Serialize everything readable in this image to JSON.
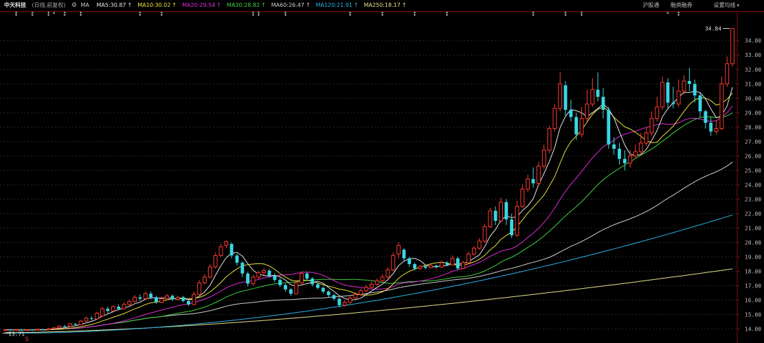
{
  "header": {
    "stock_name": "中天科技",
    "period": "(日线,前复权)",
    "ma_label": "MA",
    "ma_items": [
      {
        "name": "MA5",
        "value": "30.87",
        "color": "#e6e6e6"
      },
      {
        "name": "MA10",
        "value": "30.02",
        "color": "#e8e13a"
      },
      {
        "name": "MA20",
        "value": "29.54",
        "color": "#e02ad8"
      },
      {
        "name": "MA30",
        "value": "28.82",
        "color": "#3fd23f"
      },
      {
        "name": "MA60",
        "value": "26.47",
        "color": "#cfcfcf"
      },
      {
        "name": "MA120",
        "value": "21.91",
        "color": "#2ab4e6"
      },
      {
        "name": "MA250",
        "value": "18.17",
        "color": "#e8e28a"
      }
    ]
  },
  "toolbar": {
    "link_hgt": "沪股通",
    "link_margin": "融资融券",
    "link_settings": "设置均线"
  },
  "chart_data": {
    "type": "candlestick",
    "y_axis_ticks": [
      "14.00",
      "15.00",
      "16.00",
      "17.00",
      "18.00",
      "19.00",
      "20.00",
      "21.00",
      "22.00",
      "23.00",
      "24.00",
      "25.00",
      "26.00",
      "27.00",
      "28.00",
      "29.00",
      "30.00",
      "31.00",
      "32.00",
      "33.00",
      "34.00"
    ],
    "ylim": [
      13.6,
      35.2
    ],
    "high_label": "34.84",
    "low_label": "13.71",
    "colors": {
      "up": "#ff3b30",
      "down": "#39d7e3",
      "grid": "#2a2a2a"
    },
    "candles": [
      [
        13.9,
        13.95,
        13.88,
        13.98
      ],
      [
        13.95,
        13.92,
        13.85,
        14.0
      ],
      [
        13.92,
        13.96,
        13.86,
        14.01
      ],
      [
        13.96,
        13.9,
        13.84,
        14.0
      ],
      [
        13.9,
        13.95,
        13.85,
        13.99
      ],
      [
        13.95,
        13.93,
        13.86,
        14.0
      ],
      [
        13.93,
        13.98,
        13.89,
        14.03
      ],
      [
        13.98,
        13.96,
        13.91,
        14.03
      ],
      [
        13.96,
        14.02,
        13.92,
        14.08
      ],
      [
        14.02,
        14.08,
        13.98,
        14.13
      ],
      [
        14.08,
        14.2,
        14.04,
        14.26
      ],
      [
        14.2,
        14.18,
        14.1,
        14.28
      ],
      [
        14.18,
        14.35,
        14.15,
        14.43
      ],
      [
        14.35,
        14.3,
        14.22,
        14.42
      ],
      [
        14.3,
        14.55,
        14.27,
        14.62
      ],
      [
        14.55,
        14.75,
        14.5,
        14.85
      ],
      [
        14.75,
        14.7,
        14.6,
        14.9
      ],
      [
        14.7,
        15.1,
        14.66,
        15.2
      ],
      [
        14.9,
        15.4,
        14.86,
        15.55
      ],
      [
        15.4,
        15.25,
        15.1,
        15.55
      ],
      [
        15.25,
        15.55,
        15.2,
        15.65
      ],
      [
        15.55,
        15.4,
        15.3,
        15.7
      ],
      [
        15.4,
        15.7,
        15.35,
        15.85
      ],
      [
        15.7,
        15.9,
        15.6,
        16.05
      ],
      [
        15.9,
        16.2,
        15.85,
        16.35
      ],
      [
        16.2,
        16.1,
        15.95,
        16.4
      ],
      [
        16.1,
        16.45,
        16.0,
        16.6
      ],
      [
        16.45,
        16.2,
        16.05,
        16.6
      ],
      [
        16.2,
        15.85,
        15.75,
        16.3
      ],
      [
        15.85,
        16.1,
        15.8,
        16.25
      ],
      [
        16.1,
        16.3,
        16.0,
        16.45
      ],
      [
        16.3,
        16.05,
        15.95,
        16.4
      ],
      [
        16.05,
        16.2,
        15.95,
        16.3
      ],
      [
        16.2,
        15.95,
        15.85,
        16.3
      ],
      [
        15.95,
        15.7,
        15.6,
        16.0
      ],
      [
        15.7,
        16.4,
        15.65,
        16.6
      ],
      [
        16.4,
        17.2,
        16.35,
        17.4
      ],
      [
        17.2,
        17.6,
        17.1,
        17.8
      ],
      [
        17.6,
        18.3,
        17.5,
        18.5
      ],
      [
        18.3,
        19.1,
        18.2,
        19.3
      ],
      [
        19.1,
        19.7,
        19.0,
        19.9
      ],
      [
        19.8,
        20.05,
        19.6,
        20.15
      ],
      [
        19.9,
        19.1,
        18.9,
        20.0
      ],
      [
        19.1,
        18.6,
        18.4,
        19.2
      ],
      [
        18.6,
        17.85,
        17.6,
        18.7
      ],
      [
        17.85,
        17.15,
        16.95,
        17.95
      ],
      [
        17.15,
        17.6,
        17.0,
        17.75
      ],
      [
        17.6,
        17.9,
        17.45,
        18.05
      ],
      [
        17.9,
        18.05,
        17.75,
        18.2
      ],
      [
        18.05,
        17.7,
        17.55,
        18.15
      ],
      [
        17.7,
        17.4,
        17.25,
        17.85
      ],
      [
        17.4,
        17.05,
        16.9,
        17.55
      ],
      [
        17.05,
        16.75,
        16.6,
        17.15
      ],
      [
        16.75,
        16.45,
        16.3,
        16.85
      ],
      [
        16.45,
        17.2,
        16.4,
        17.4
      ],
      [
        17.2,
        17.85,
        17.1,
        18.0
      ],
      [
        17.85,
        17.5,
        17.35,
        17.95
      ],
      [
        17.5,
        17.1,
        16.95,
        17.6
      ],
      [
        17.1,
        16.85,
        16.75,
        17.2
      ],
      [
        16.85,
        16.6,
        16.45,
        16.95
      ],
      [
        16.6,
        16.35,
        16.2,
        16.7
      ],
      [
        16.35,
        16.1,
        16.0,
        16.45
      ],
      [
        16.1,
        15.65,
        15.5,
        16.2
      ],
      [
        15.65,
        15.85,
        15.55,
        16.0
      ],
      [
        15.85,
        16.15,
        15.75,
        16.3
      ],
      [
        16.15,
        16.4,
        16.05,
        16.55
      ],
      [
        16.4,
        16.65,
        16.3,
        16.8
      ],
      [
        16.65,
        16.9,
        16.55,
        17.05
      ],
      [
        16.9,
        17.1,
        16.8,
        17.3
      ],
      [
        17.1,
        17.35,
        17.0,
        17.5
      ],
      [
        17.35,
        17.6,
        17.25,
        17.8
      ],
      [
        17.6,
        18.1,
        17.5,
        18.3
      ],
      [
        18.1,
        19.1,
        18.0,
        19.3
      ],
      [
        19.2,
        19.8,
        18.9,
        20.0
      ],
      [
        19.5,
        18.9,
        18.7,
        19.6
      ],
      [
        18.9,
        18.5,
        18.3,
        19.0
      ],
      [
        18.5,
        18.2,
        18.05,
        18.6
      ],
      [
        18.2,
        18.35,
        18.1,
        18.45
      ],
      [
        18.35,
        18.25,
        18.15,
        18.4
      ],
      [
        18.25,
        18.4,
        18.2,
        18.5
      ],
      [
        18.4,
        18.3,
        18.2,
        18.45
      ],
      [
        18.3,
        18.6,
        18.25,
        18.75
      ],
      [
        18.6,
        18.45,
        18.35,
        18.7
      ],
      [
        18.45,
        18.9,
        18.4,
        19.1
      ],
      [
        18.9,
        18.2,
        18.1,
        19.0
      ],
      [
        18.2,
        18.6,
        18.15,
        18.75
      ],
      [
        18.6,
        19.2,
        18.55,
        19.4
      ],
      [
        19.2,
        19.6,
        19.1,
        19.75
      ],
      [
        19.6,
        20.1,
        19.5,
        20.3
      ],
      [
        20.1,
        21.1,
        20.0,
        21.3
      ],
      [
        21.1,
        22.2,
        21.0,
        22.4
      ],
      [
        22.2,
        21.5,
        21.2,
        22.5
      ],
      [
        21.5,
        22.8,
        21.4,
        23.1
      ],
      [
        22.8,
        21.6,
        21.2,
        23.0
      ],
      [
        21.6,
        20.5,
        20.3,
        22.0
      ],
      [
        20.5,
        22.5,
        20.4,
        22.9
      ],
      [
        22.5,
        23.7,
        22.4,
        24.0
      ],
      [
        23.7,
        24.4,
        23.5,
        24.7
      ],
      [
        24.4,
        24.1,
        23.8,
        25.2
      ],
      [
        24.1,
        25.3,
        24.0,
        25.6
      ],
      [
        25.3,
        26.4,
        25.1,
        26.8
      ],
      [
        26.4,
        27.9,
        26.2,
        28.1
      ],
      [
        27.9,
        29.3,
        27.7,
        29.6
      ],
      [
        29.3,
        31.0,
        29.1,
        31.8
      ],
      [
        30.9,
        29.2,
        28.8,
        31.2
      ],
      [
        29.2,
        28.7,
        28.4,
        29.9
      ],
      [
        28.7,
        27.5,
        27.1,
        29.0
      ],
      [
        27.5,
        28.6,
        27.3,
        29.4
      ],
      [
        28.6,
        29.6,
        28.4,
        30.6
      ],
      [
        29.6,
        30.6,
        29.4,
        31.4
      ],
      [
        30.6,
        30.1,
        29.8,
        31.8
      ],
      [
        30.1,
        29.2,
        28.6,
        30.7
      ],
      [
        29.2,
        26.8,
        26.5,
        29.4
      ],
      [
        26.8,
        26.5,
        26.1,
        27.3
      ],
      [
        26.5,
        25.8,
        25.4,
        26.9
      ],
      [
        25.8,
        25.5,
        25.0,
        26.4
      ],
      [
        25.5,
        26.0,
        25.2,
        26.4
      ],
      [
        26.0,
        26.3,
        25.8,
        26.8
      ],
      [
        26.3,
        26.9,
        26.1,
        27.6
      ],
      [
        26.9,
        27.6,
        26.7,
        28.0
      ],
      [
        27.6,
        28.6,
        27.4,
        29.1
      ],
      [
        28.6,
        29.4,
        28.4,
        30.1
      ],
      [
        29.4,
        31.1,
        29.2,
        31.5
      ],
      [
        31.1,
        29.7,
        29.2,
        31.4
      ],
      [
        29.7,
        29.6,
        29.3,
        30.8
      ],
      [
        29.6,
        30.5,
        29.4,
        31.3
      ],
      [
        30.5,
        31.2,
        30.3,
        31.6
      ],
      [
        31.2,
        31.0,
        30.5,
        32.1
      ],
      [
        31.0,
        30.2,
        29.7,
        31.3
      ],
      [
        30.2,
        29.1,
        28.7,
        30.4
      ],
      [
        29.1,
        28.3,
        27.9,
        29.2
      ],
      [
        28.3,
        27.7,
        27.4,
        28.7
      ],
      [
        27.7,
        27.9,
        27.5,
        28.5
      ],
      [
        27.9,
        31.0,
        27.8,
        31.5
      ],
      [
        31.0,
        32.4,
        30.8,
        32.9
      ],
      [
        32.4,
        34.84,
        32.2,
        34.84
      ]
    ]
  }
}
